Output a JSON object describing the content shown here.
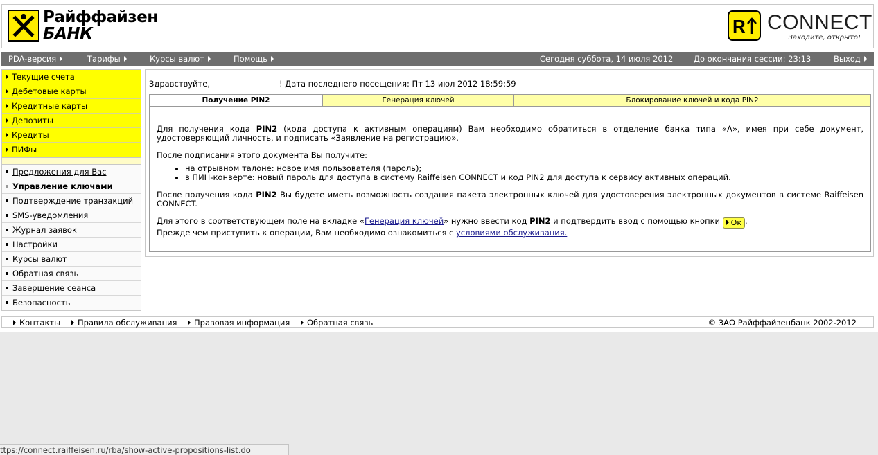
{
  "header": {
    "bank_name_line1": "Райффайзен",
    "bank_name_line2": "БАНК",
    "connect_logo_text": "CONNECT",
    "connect_slogan": "Заходите, открыто!",
    "brand_yellow": "#ffed00"
  },
  "topnav": {
    "items": [
      "PDA-версия",
      "Тарифы",
      "Курсы валют",
      "Помощь"
    ],
    "date_text": "Сегодня суббота, 14 июля 2012",
    "session_text": "До окончания сессии: 23:13",
    "logout_label": "Выход"
  },
  "sidebar": {
    "primary_items": [
      "Текущие счета",
      "Дебетовые карты",
      "Кредитные карты",
      "Депозиты",
      "Кредиты",
      "ПИФы"
    ],
    "secondary_items": [
      "Предложения для Вас",
      "Управление ключами",
      "Подтверждение транзакций",
      "SMS-уведомления",
      "Журнал заявок",
      "Настройки",
      "Курсы валют",
      "Обратная связь",
      "Завершение сеанса",
      "Безопасность"
    ]
  },
  "main": {
    "greeting": "Здравствуйте,",
    "greeting_end": "! Дата последнего посещения: Пт 13 июл 2012 18:59:59",
    "tabs": [
      "Получение PIN2",
      "Генерация ключей",
      "Блокирование ключей и кода PIN2"
    ],
    "p1_a": "Для получения кода ",
    "p1_bold": "PIN2",
    "p1_b": " (кода доступа к активным операциям) Вам необходимо обратиться в отделение банка типа «А», имея при себе документ, удостоверяющий личность, и подписать «Заявление на регистрацию».",
    "p2": "После подписания этого документа Вы получите:",
    "bullets": [
      "на отрывном талоне: новое имя пользователя (пароль);",
      "в ПИН-конверте: новый пароль для доступа в систему Raiffeisen CONNECT и код PIN2 для доступа к сервису активных операций."
    ],
    "p3_a": "После получения кода ",
    "p3_bold": "PIN2",
    "p3_b": " Вы будете иметь возможность создания пакета электронных ключей для удостоверения электронных документов в системе Raiffeisen CONNECT.",
    "p4_a": "Для этого в соответствующем поле на вкладке «",
    "p4_link": "Генерация ключей",
    "p4_b": "» нужно ввести код ",
    "p4_bold": "PIN2",
    "p4_c": " и подтвердить ввод с помощью кнопки ",
    "ok_label": "Ок",
    "p4_d": ".",
    "p5_a": "Прежде чем приступить к операции, Вам необходимо ознакомиться с ",
    "p5_link": "условиями обслуживания."
  },
  "footer": {
    "links": [
      "Контакты",
      "Правила обслуживания",
      "Правовая информация",
      "Обратная связь"
    ],
    "copyright": "© ЗАО Райффайзенбанк 2002-2012"
  },
  "statusbar": {
    "url": "ttps://connect.raiffeisen.ru/rba/show-active-propositions-list.do"
  }
}
